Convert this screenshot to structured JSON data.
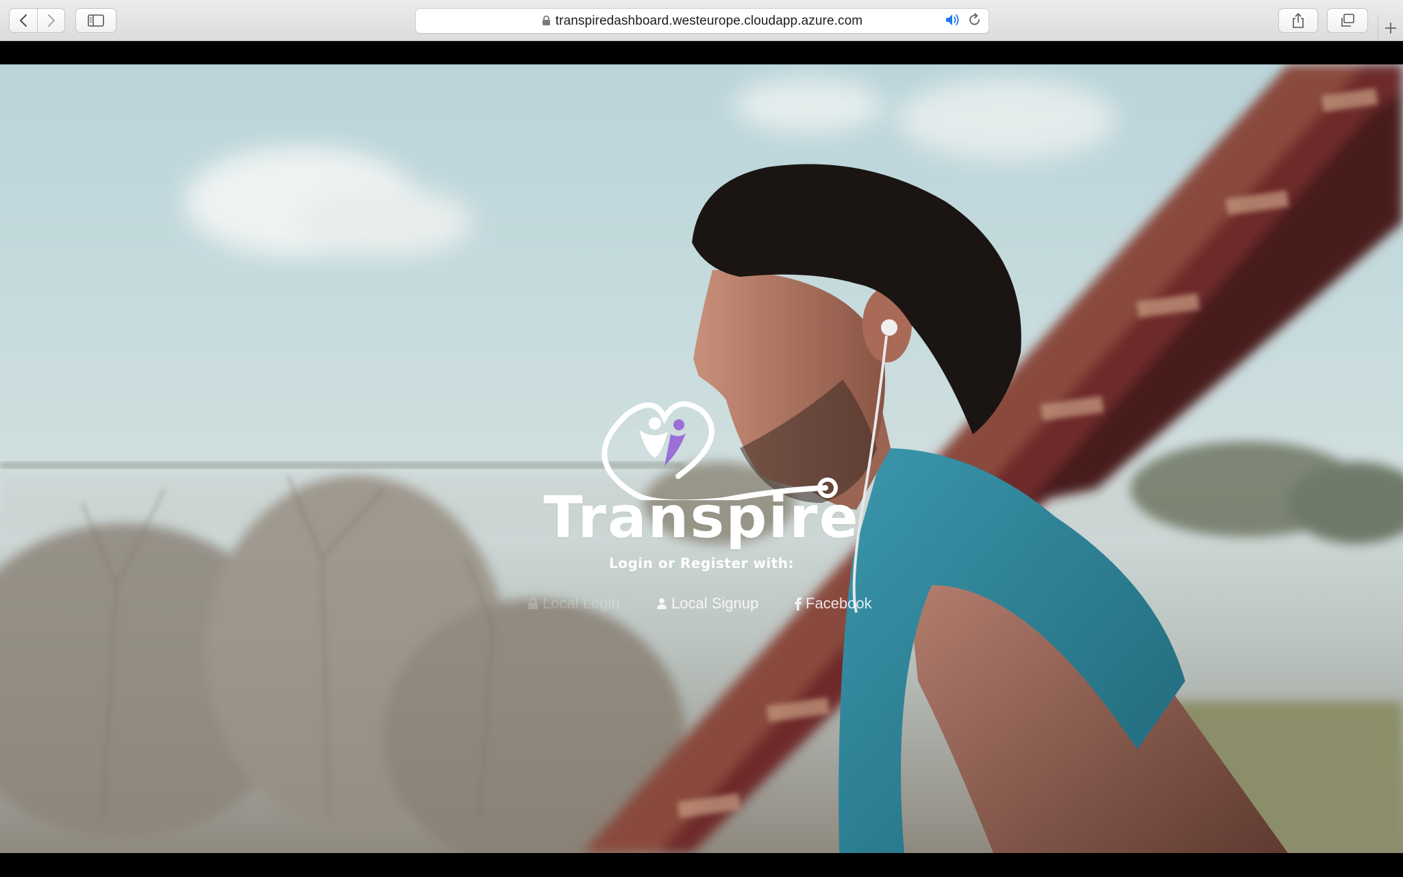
{
  "browser": {
    "url": "transpiredashboard.westeurope.cloudapp.azure.com",
    "icons": {
      "back": "chevron-left-icon",
      "forward": "chevron-right-icon",
      "sidebar": "sidebar-icon",
      "lock": "lock-icon",
      "audio": "speaker-icon",
      "reload": "reload-icon",
      "share": "share-icon",
      "tabs": "tabs-overview-icon",
      "new_tab": "plus-icon"
    }
  },
  "page": {
    "brand_name": "Transpire",
    "subtitle": "Login or Register with:",
    "auth_options": [
      {
        "label": "Local Login",
        "icon": "lock-icon"
      },
      {
        "label": "Local Signup",
        "icon": "user-icon"
      },
      {
        "label": "Facebook",
        "icon": "facebook-icon"
      }
    ]
  },
  "colors": {
    "accent_purple": "#9b6fd6",
    "text_white": "#ffffff",
    "audio_blue": "#1e7cf0"
  }
}
